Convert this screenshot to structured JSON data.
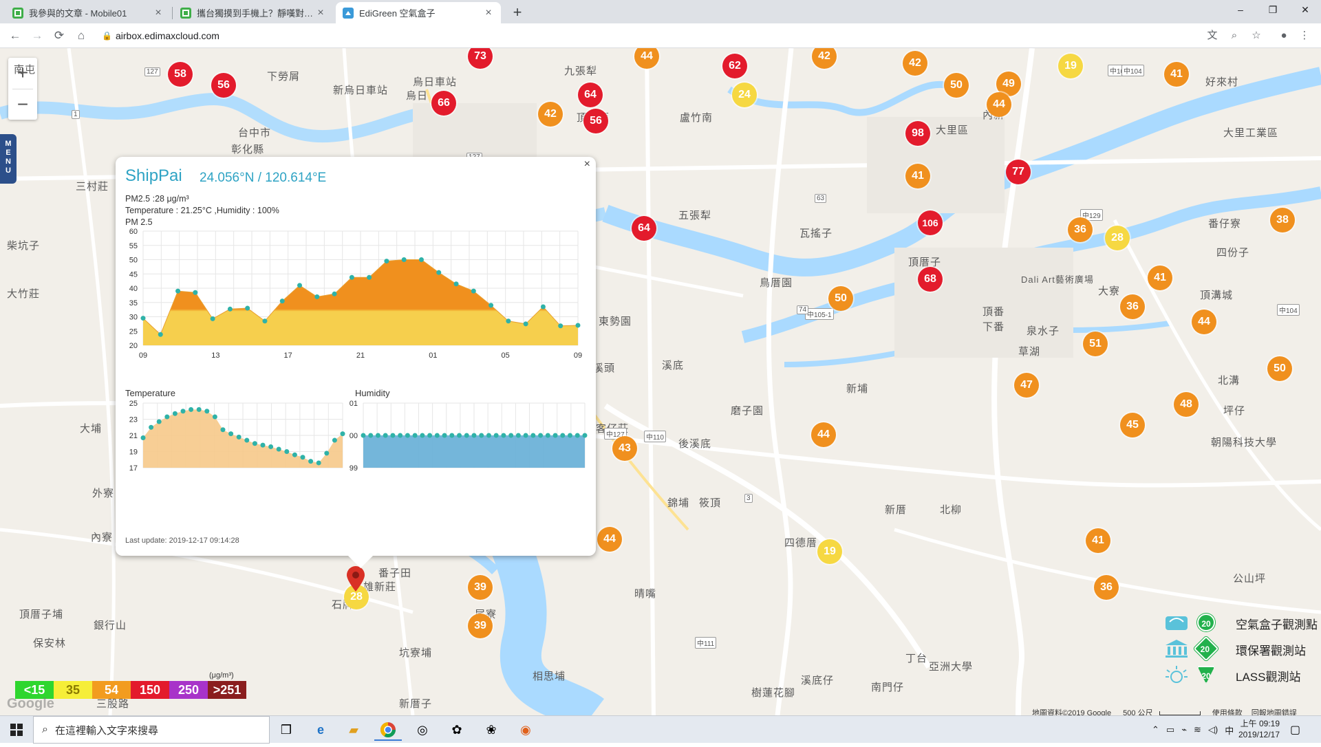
{
  "browser": {
    "tabs": [
      {
        "title": "我參與的文章 - Mobile01",
        "favicon": "mobile01-icon",
        "active": false
      },
      {
        "title": "攜台獨摸到手機上？靜嘆對中國有...",
        "favicon": "mobile01-icon",
        "active": false
      },
      {
        "title": "EdiGreen 空氣盒子",
        "favicon": "edigreen-icon",
        "active": true
      }
    ],
    "url": "airbox.edimaxcloud.com",
    "window_controls": {
      "minimize": "–",
      "maximize": "❐",
      "close": "✕"
    }
  },
  "map": {
    "zoom_in": "+",
    "zoom_out": "−",
    "menu_label": [
      "M",
      "E",
      "N",
      "U"
    ],
    "place_labels": [
      "南屯",
      "九張犁",
      "下勞屑",
      "烏日",
      "烏日車站",
      "新烏日車站",
      "台中市",
      "彰化縣",
      "頂前厝",
      "盧竹南",
      "大里區",
      "大里工業區",
      "好來村",
      "內新",
      "五張犁",
      "瓦搖子",
      "番仔寮",
      "四份子",
      "三村莊",
      "柴坑子",
      "大竹莊",
      "東勢園",
      "溪底",
      "鳥厝園",
      "新埔",
      "頂溝城",
      "頂番",
      "下番",
      "泉水子",
      "北溝",
      "坪仔",
      "草湖",
      "頂厝子",
      "磨子園",
      "後溪底",
      "錦埔",
      "筱頂",
      "四德厝",
      "新厝",
      "北柳",
      "大埔",
      "客仔莊",
      "溪頭",
      "番子田",
      "石牌",
      "雄新莊",
      "坑寮埔",
      "尾寮",
      "晴嘴",
      "頂厝子埔",
      "銀行山",
      "保安林",
      "相思埔",
      "新厝子",
      "樹蓮花腳",
      "溪底仔",
      "南門仔",
      "丁台",
      "亞洲大學",
      "公山坪",
      "朝陽科技大學",
      "三股路",
      "外寮",
      "內寮",
      "Dali Art藝術廣場",
      "大寮"
    ],
    "markers": [
      {
        "value": "58",
        "level": "red"
      },
      {
        "value": "56",
        "level": "red"
      },
      {
        "value": "73",
        "level": "red"
      },
      {
        "value": "66",
        "level": "red"
      },
      {
        "value": "64",
        "level": "red"
      },
      {
        "value": "56",
        "level": "red"
      },
      {
        "value": "42",
        "level": "orange"
      },
      {
        "value": "44",
        "level": "orange"
      },
      {
        "value": "62",
        "level": "red"
      },
      {
        "value": "24",
        "level": "yellow"
      },
      {
        "value": "42",
        "level": "orange"
      },
      {
        "value": "42",
        "level": "orange"
      },
      {
        "value": "50",
        "level": "orange"
      },
      {
        "value": "49",
        "level": "orange"
      },
      {
        "value": "44",
        "level": "orange"
      },
      {
        "value": "19",
        "level": "yellow"
      },
      {
        "value": "41",
        "level": "orange"
      },
      {
        "value": "98",
        "level": "red"
      },
      {
        "value": "41",
        "level": "orange"
      },
      {
        "value": "77",
        "level": "red"
      },
      {
        "value": "64",
        "level": "red"
      },
      {
        "value": "106",
        "level": "red"
      },
      {
        "value": "36",
        "level": "orange"
      },
      {
        "value": "28",
        "level": "yellow"
      },
      {
        "value": "38",
        "level": "orange"
      },
      {
        "value": "68",
        "level": "red"
      },
      {
        "value": "41",
        "level": "orange"
      },
      {
        "value": "50",
        "level": "orange"
      },
      {
        "value": "36",
        "level": "orange"
      },
      {
        "value": "44",
        "level": "orange"
      },
      {
        "value": "51",
        "level": "orange"
      },
      {
        "value": "47",
        "level": "orange"
      },
      {
        "value": "50",
        "level": "orange"
      },
      {
        "value": "48",
        "level": "orange"
      },
      {
        "value": "45",
        "level": "orange"
      },
      {
        "value": "44",
        "level": "orange"
      },
      {
        "value": "43",
        "level": "orange"
      },
      {
        "value": "44",
        "level": "orange"
      },
      {
        "value": "19",
        "level": "yellow"
      },
      {
        "value": "41",
        "level": "orange"
      },
      {
        "value": "36",
        "level": "orange"
      },
      {
        "value": "39",
        "level": "orange"
      },
      {
        "value": "39",
        "level": "orange"
      },
      {
        "value": "28",
        "level": "yellow"
      }
    ],
    "road_labels": [
      "中127",
      "中111",
      "中105-1",
      "中110",
      "中104",
      "中129",
      "中102",
      "中104",
      "127",
      "127",
      "63",
      "74",
      "3",
      "1"
    ]
  },
  "popup": {
    "close": "×",
    "title": "ShipPai",
    "coords": "24.056°N / 120.614°E",
    "pm25_line": "PM2.5 :28 μg/m³",
    "temp_line": "Temperature : 21.25°C ,Humidity : 100%",
    "pm25_chart_label": "PM 2.5",
    "temperature_chart_label": "Temperature",
    "humidity_chart_label": "Humidity",
    "last_update": "Last update: 2019-12-17 09:14:28"
  },
  "chart_data": [
    {
      "type": "area",
      "title": "PM 2.5",
      "x_ticks": [
        "09",
        "13",
        "17",
        "21",
        "01",
        "05",
        "09"
      ],
      "y_ticks": [
        20,
        25,
        30,
        35,
        40,
        45,
        50,
        55,
        60
      ],
      "ylim": [
        20,
        60
      ],
      "values": [
        29.5,
        23.8,
        39,
        38.5,
        29.3,
        32.7,
        33,
        28.5,
        35.5,
        41,
        37,
        38,
        43.8,
        43.8,
        49.5,
        50,
        50,
        45.5,
        41.5,
        39,
        34,
        28.5,
        27.5,
        33.5,
        26.8,
        27
      ],
      "colors": {
        "fill_low": "#f6cf4d",
        "fill_high": "#f0901e",
        "line": "#2fb2a8"
      }
    },
    {
      "type": "area",
      "title": "Temperature",
      "y_ticks": [
        17,
        19,
        21,
        23,
        25
      ],
      "ylim": [
        17,
        25
      ],
      "values": [
        20.7,
        22,
        22.7,
        23.3,
        23.7,
        24,
        24.2,
        24.2,
        24,
        23.3,
        21.7,
        21.2,
        20.8,
        20.4,
        20,
        19.8,
        19.6,
        19.3,
        19,
        18.6,
        18.3,
        17.8,
        17.6,
        18.8,
        20.4,
        21.2
      ],
      "colors": {
        "fill": "#f6c98a",
        "line": "#2fb2a8"
      }
    },
    {
      "type": "area",
      "title": "Humidity",
      "y_ticks": [
        99,
        100,
        101
      ],
      "ylim": [
        99,
        101
      ],
      "values": [
        100,
        100,
        100,
        100,
        100,
        100,
        100,
        100,
        100,
        100,
        100,
        100,
        100,
        100,
        100,
        100,
        100,
        100,
        100,
        100,
        100,
        100,
        100,
        100,
        100,
        100,
        100,
        100,
        100,
        100,
        100
      ],
      "colors": {
        "fill": "#6db2d8",
        "line": "#2fb2a8"
      }
    }
  ],
  "legend": {
    "unit": "(μg/m³)",
    "segments": [
      {
        "label": "<15",
        "color": "#2ed62e"
      },
      {
        "label": "35",
        "color": "#f6ee38"
      },
      {
        "label": "54",
        "color": "#f29c1f"
      },
      {
        "label": "150",
        "color": "#e31b2c"
      },
      {
        "label": "250",
        "color": "#a833c9"
      },
      {
        "label": ">251",
        "color": "#8a1e1e"
      }
    ],
    "stations": [
      {
        "label": "空氣盒子觀測點",
        "badge": "20"
      },
      {
        "label": "環保署觀測站",
        "badge": "20"
      },
      {
        "label": "LASS觀測站",
        "badge": "20"
      }
    ]
  },
  "attribution": {
    "map_data": "地圖資料©2019 Google",
    "scale": "500 公尺",
    "terms": "使用條款",
    "report": "回報地圖錯誤",
    "logo": "Google"
  },
  "taskbar": {
    "search_placeholder": "在這裡輸入文字來搜尋",
    "ime": "中",
    "time": "上午 09:19",
    "date": "2019/12/17"
  }
}
